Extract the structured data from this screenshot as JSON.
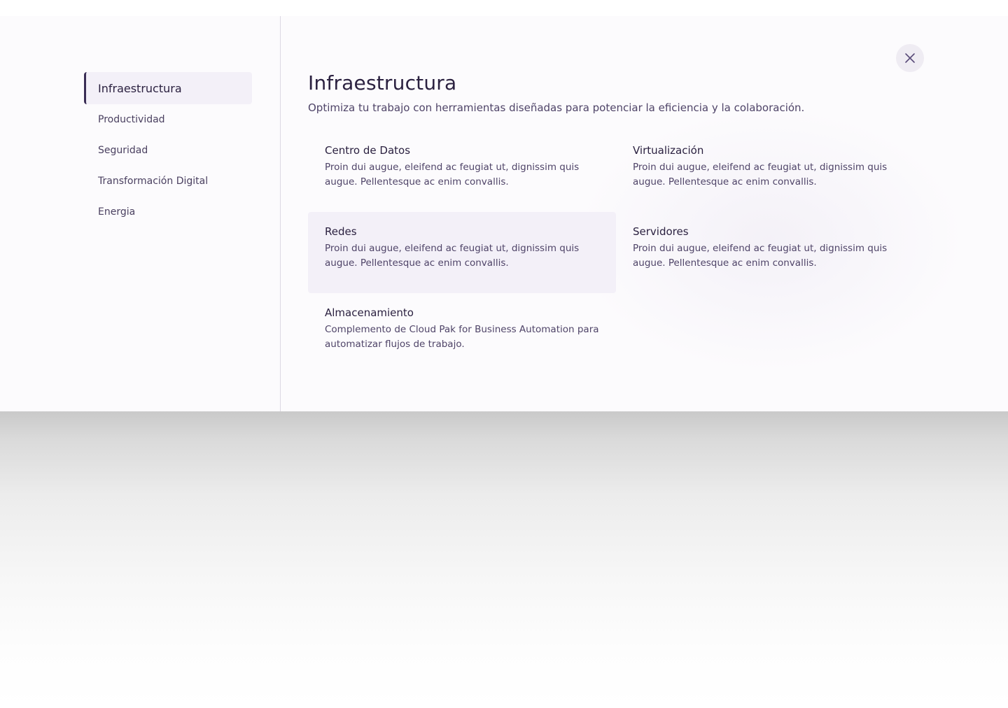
{
  "sidebar": {
    "items": [
      {
        "label": "Infraestructura",
        "active": true
      },
      {
        "label": "Productividad",
        "active": false
      },
      {
        "label": "Seguridad",
        "active": false
      },
      {
        "label": "Transformación Digital",
        "active": false
      },
      {
        "label": "Energia",
        "active": false
      }
    ]
  },
  "main": {
    "title": "Infraestructura",
    "subtitle": "Optimiza tu trabajo con herramientas diseñadas para potenciar la eficiencia y la colaboración.",
    "close_icon": "close-icon",
    "cards": [
      {
        "title": "Centro de Datos",
        "description": "Proin dui augue, eleifend ac feugiat ut, dignissim quis augue. Pellentesque ac enim convallis."
      },
      {
        "title": "Virtualización",
        "description": "Proin dui augue, eleifend ac feugiat ut, dignissim quis augue. Pellentesque ac enim convallis."
      },
      {
        "title": "Redes",
        "description": "Proin dui augue, eleifend ac feugiat ut, dignissim quis augue. Pellentesque ac enim convallis."
      },
      {
        "title": "Servidores",
        "description": "Proin dui augue, eleifend ac feugiat ut, dignissim quis augue. Pellentesque ac enim convallis."
      },
      {
        "title": "Almacenamiento",
        "description": "Complemento de Cloud Pak for Business Automation para automatizar flujos de trabajo."
      }
    ]
  },
  "colors": {
    "accent": "#3a2d55",
    "active_bg": "#f3f0f8",
    "text_primary": "#2b2140",
    "text_secondary": "#4f4468"
  }
}
